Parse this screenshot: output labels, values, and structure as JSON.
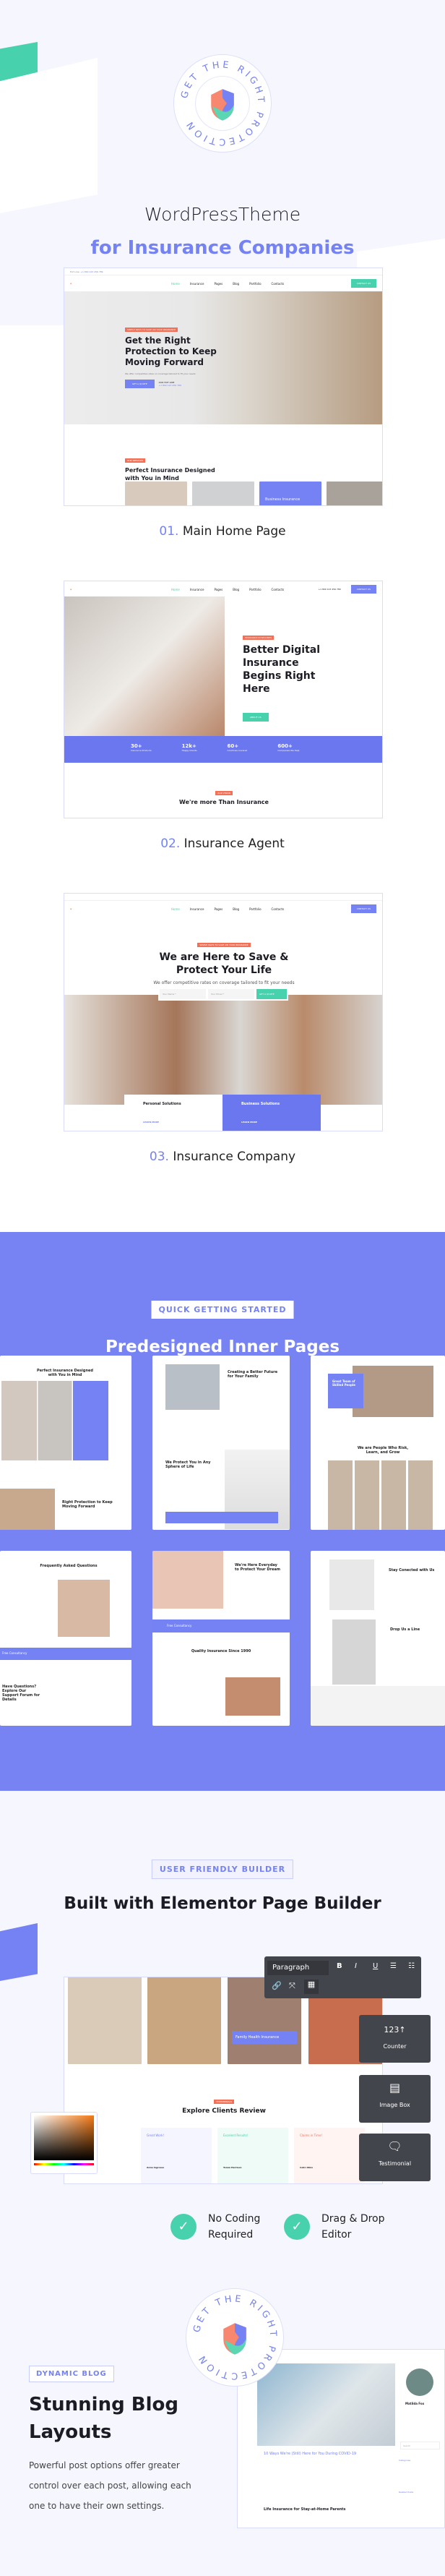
{
  "colors": {
    "accent": "#7582f4",
    "green": "#47d1ad",
    "orange": "#f36f56",
    "bg": "#f5f6fe"
  },
  "logo": {
    "ring_text": "GET THE RIGHT PROTECTION",
    "icon": "shield-icon"
  },
  "hero": {
    "line1": "WordPressTheme",
    "line2": "for Insurance Companies"
  },
  "demos": [
    {
      "num": "01.",
      "label": "Main Home Page",
      "nav": [
        "Home",
        "Insurance",
        "Pages",
        "Blog",
        "Portfolio",
        "Contacts"
      ],
      "cta": "CONTACT US",
      "tag": "SIMPLE WAYS TO SAVE ON YOUR INSURANCE",
      "heading": "Get the Right Protection to Keep Moving Forward",
      "sub": "We offer competitive rates on coverage tailored to fit your needs",
      "button": "GET A QUOTE",
      "hotline_label": "OUR HOT LINE",
      "hotline": "+1 800 123 456 789",
      "services_tag": "OUR SERVICES",
      "services_heading": "Perfect Insurance Designed with You in Mind",
      "service_card": "Business Insurance"
    },
    {
      "num": "02.",
      "label": "Insurance Agent",
      "nav": [
        "Home",
        "Insurance",
        "Pages",
        "Blog",
        "Portfolio",
        "Contacts"
      ],
      "cta": "CONTACT US",
      "phone": "+1 800 123 456 789",
      "tag": "INSURANCE IN SECONDS",
      "heading": "Better Digital Insurance Begins Right Here",
      "button": "ABOUT US",
      "stats": [
        {
          "value": "30+",
          "label": "Insurance Products"
        },
        {
          "value": "12k+",
          "label": "Happy Clients"
        },
        {
          "value": "60+",
          "label": "Countries Covered"
        },
        {
          "value": "600+",
          "label": "Companies We Help"
        }
      ],
      "vision_tag": "OUR VISION",
      "vision_heading": "We're more Than Insurance"
    },
    {
      "num": "03.",
      "label": "Insurance Company",
      "nav": [
        "Home",
        "Insurance",
        "Pages",
        "Blog",
        "Portfolio",
        "Contacts"
      ],
      "cta": "CONTACT US",
      "tag": "SIMPLE WAYS TO SAVE ON YOUR INSURANCE",
      "heading": "We are Here to Save & Protect Your Life",
      "sub": "We offer competitive rates on coverage tailored to fit your needs",
      "name_placeholder": "Your Name *",
      "email_placeholder": "Your Email *",
      "button": "GET A QUOTE",
      "cards": [
        {
          "title": "Personal Solutions",
          "link": "LEARN MORE"
        },
        {
          "title": "Business Solutions",
          "link": "LEARN MORE"
        }
      ]
    }
  ],
  "inner": {
    "badge": "QUICK GETTING STARTED",
    "title": "Predesigned Inner Pages",
    "pages": [
      {
        "heading": "Perfect Insurance Designed with You in Mind",
        "sub": "Right Protection to Keep Moving Forward"
      },
      {
        "heading": "Creating a Better Future for Your Family",
        "sub": "We Protect You in Any Sphere of Life"
      },
      {
        "heading": "Great Team of Skilled People",
        "sub": "We are People Who Risk, Learn, and Grow"
      },
      {
        "heading": "Frequently Asked Questions",
        "sub": "Have Questions? Explore Our Support Forum for Details"
      },
      {
        "heading": "We're Here Everyday to Protect Your Dream",
        "sub": "Quality Insurance Since 1990"
      },
      {
        "heading": "Stay Conected with Us",
        "sub": "Drop Us a Line"
      }
    ],
    "free_consultancy": "Free Consultancy"
  },
  "builder": {
    "badge": "USER FRIENDLY BUILDER",
    "title": "Built with Elementor Page Builder",
    "toolbar": {
      "format": "Paragraph",
      "bold": "B",
      "italic": "I",
      "underline": "U"
    },
    "widgets": [
      {
        "label": "Counter",
        "icon": "counter-icon",
        "glyph": "123↑"
      },
      {
        "label": "Image Box",
        "icon": "image-box-icon",
        "glyph": "▤"
      },
      {
        "label": "Testimonial",
        "icon": "speech-bubble-icon",
        "glyph": "💬"
      }
    ],
    "photo_caption": "Family Health Insurance",
    "reviews_tag": "TESTIMONIALS",
    "reviews_title": "Explore Clients Review",
    "reviews": [
      {
        "title": "Great Work!",
        "name": "Anna Ingrosso",
        "color": "#7582f4"
      },
      {
        "title": "Excelent Results!",
        "name": "Tomm Harrison",
        "color": "#47d1ad"
      },
      {
        "title": "Claims in Time!",
        "name": "Colin Olins",
        "color": "#f36f56"
      }
    ],
    "features": [
      "No Coding Required",
      "Drag & Drop Editor"
    ]
  },
  "blog": {
    "badge": "DYNAMIC BLOG",
    "title": "Stunning Blog Layouts",
    "text": "Powerful post options offer greater control over each post, allowing each one to have their own settings.",
    "post1": "10 Ways We're (Still) Here for You During COVID-19",
    "post2": "Life Insurance for Stay-at-Home Parents",
    "author": "Matilda Fox",
    "categories_label": "Categories",
    "related_label": "Related Posts",
    "search_placeholder": "Search"
  }
}
